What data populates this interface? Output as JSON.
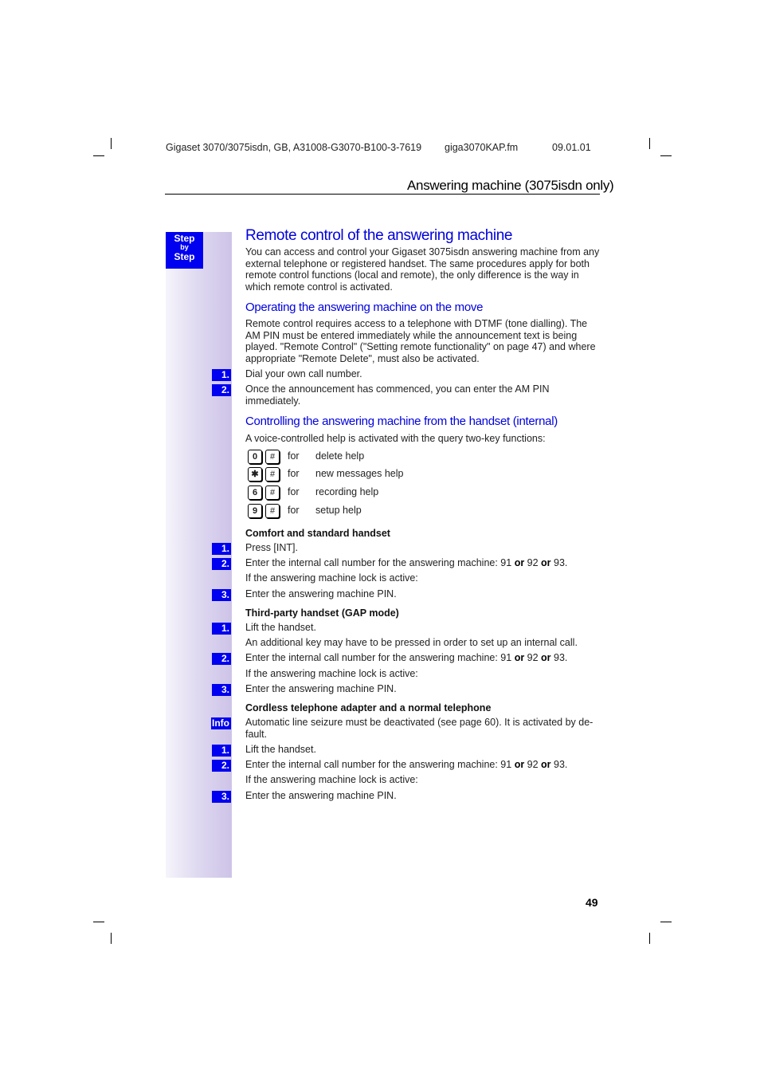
{
  "header": {
    "doc_id": "Gigaset 3070/3075isdn, GB, A31008-G3070-B100-3-7619",
    "file": "giga3070KAP.fm",
    "date": "09.01.01",
    "section_title": "Answering machine (3075isdn only)"
  },
  "sidebar": {
    "step_label_1": "Step",
    "step_label_2": "by",
    "step_label_3": "Step"
  },
  "main": {
    "title": "Remote control of the answering machine",
    "intro": "You can access and control your Gigaset 3075isdn answering machine from any external telephone or registered handset. The same procedures apply for both remote control functions (local and remote), the only difference is the way in which remote control is activated.",
    "move": {
      "heading": "Operating the answering machine on the move",
      "text": "Remote control requires access to a telephone with DTMF (tone dialling). The AM PIN must be entered immediately while the announcement text is being played. \"Remote Control\" (\"Setting remote functionality\" on page 47) and where appropriate \"Remote Delete\", must also be activated.",
      "steps": [
        {
          "num": "1.",
          "text": "Dial your own call number."
        },
        {
          "num": "2.",
          "text": "Once the announcement has commenced, you can enter the AM PIN immediately."
        }
      ]
    },
    "internal": {
      "heading": "Controlling the answering machine from the handset (internal)",
      "text": "A voice-controlled help is activated with the query two-key functions:",
      "keys": [
        {
          "key1": "0",
          "key2": "#",
          "for": "for",
          "desc": "delete help"
        },
        {
          "key1": "✱",
          "key2": "#",
          "for": "for",
          "desc": "new messages help"
        },
        {
          "key1": "6",
          "key2": "#",
          "for": "for",
          "desc": "recording help"
        },
        {
          "key1": "9",
          "key2": "#",
          "for": "for",
          "desc": "setup help"
        }
      ]
    },
    "comfort": {
      "heading": "Comfort and standard handset",
      "step1_num": "1.",
      "step1": "Press [INT].",
      "step2_num": "2.",
      "step2_pre": "Enter the internal call number for the answering machine: 91 ",
      "or": "or",
      "mid": " 92 ",
      "end": " 93.",
      "note": "If the answering machine lock is active:",
      "step3_num": "3.",
      "step3": "Enter the answering machine PIN."
    },
    "gap": {
      "heading": "Third-party handset (GAP mode)",
      "step1_num": "1.",
      "step1": "Lift the handset.",
      "note1": "An additional key may have to be pressed in order to set up an internal call.",
      "step2_num": "2.",
      "step2_pre": "Enter the internal call number for the answering machine: 91 ",
      "or": "or",
      "mid": " 92 ",
      "end": " 93.",
      "note2": "If the answering machine lock is active:",
      "step3_num": "3.",
      "step3": "Enter the answering machine PIN."
    },
    "cordless": {
      "heading": "Cordless telephone adapter and a normal telephone",
      "info_label": "Info",
      "info_text": "Automatic line seizure must be deactivated (see page 60). It is activated by de-fault.",
      "step1_num": "1.",
      "step1": "Lift the handset.",
      "step2_num": "2.",
      "step2_pre": "Enter the internal call number for the answering machine: 91 ",
      "or": "or",
      "mid": " 92 ",
      "end": " 93.",
      "note": "If the answering machine lock is active:",
      "step3_num": "3.",
      "step3": "Enter the answering machine PIN."
    }
  },
  "footer": {
    "page_number": "49"
  },
  "colors": {
    "accent_blue": "#0000f0",
    "heading_blue": "#0000dd"
  }
}
